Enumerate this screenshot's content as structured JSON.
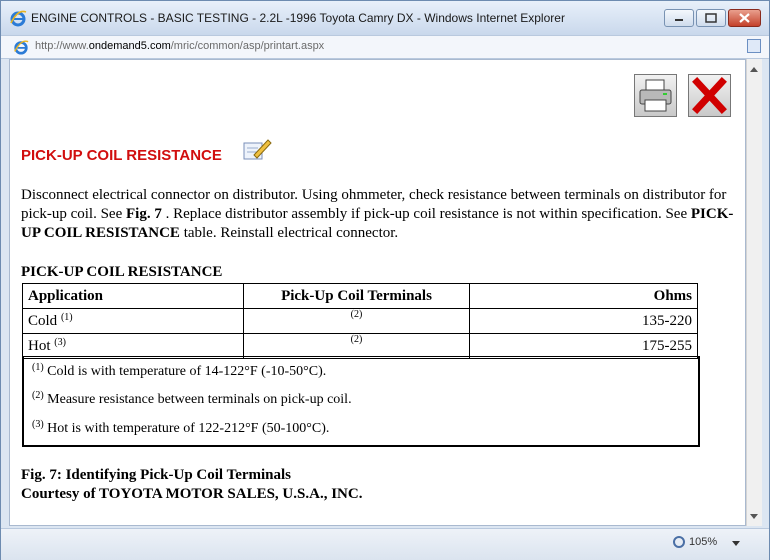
{
  "window": {
    "title": "ENGINE CONTROLS - BASIC TESTING - 2.2L -1996 Toyota Camry DX - Windows Internet Explorer",
    "address_prefix": "http://www.",
    "address_domain": "ondemand5.com",
    "address_path": "/mric/common/asp/printart.aspx"
  },
  "toolbar": {
    "print_icon": "printer-icon",
    "close_icon": "red-x-icon"
  },
  "article": {
    "heading": "PICK-UP COIL RESISTANCE",
    "para_1": "Disconnect electrical connector on distributor. Using ohmmeter, check resistance between terminals on distributor for pick-up coil. See ",
    "fig_ref": "Fig. 7",
    "para_2": " . Replace distributor assembly if pick-up coil resistance is not within specification. See ",
    "table_ref": "PICK-UP COIL RESISTANCE",
    "para_3": " table. Reinstall electrical connector.",
    "table_title": "PICK-UP COIL RESISTANCE",
    "columns": [
      "Application",
      "Pick-Up Coil Terminals",
      "Ohms"
    ],
    "rows": [
      {
        "application": "Cold",
        "app_note": "(1)",
        "terminals": "(2)",
        "ohms": "135-220"
      },
      {
        "application": "Hot",
        "app_note": "(3)",
        "terminals": "(2)",
        "ohms": "175-255"
      }
    ],
    "notes": [
      {
        "marker": "(1)",
        "text": "Cold is with temperature of 14-122°F (-10-50°C)."
      },
      {
        "marker": "(2)",
        "text": "Measure resistance between terminals on pick-up coil."
      },
      {
        "marker": "(3)",
        "text": "Hot is with temperature of 122-212°F (50-100°C)."
      }
    ],
    "figure_caption": "Fig. 7: Identifying Pick-Up Coil Terminals",
    "courtesy": "Courtesy of TOYOTA MOTOR SALES, U.S.A., INC."
  },
  "status": {
    "zoom": "105%"
  },
  "colors": {
    "heading": "#d10e0e",
    "close_x": "#d00000"
  }
}
